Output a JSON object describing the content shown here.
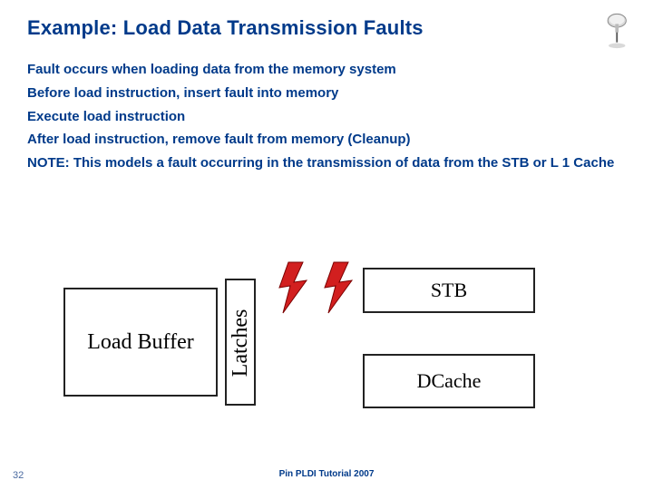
{
  "title": "Example: Load Data Transmission Faults",
  "bullets": {
    "b1": "Fault occurs when loading data from the memory system",
    "b2": "Before load instruction, insert fault into memory",
    "b3": "Execute load instruction",
    "b4": "After load instruction, remove fault from memory (Cleanup)",
    "b5": "NOTE: This models a fault occurring in the transmission of data from the STB or L 1 Cache"
  },
  "diagram": {
    "load_buffer": "Load Buffer",
    "latches": "Latches",
    "stb": "STB",
    "dcache": "DCache"
  },
  "footer": "Pin PLDI Tutorial 2007",
  "page_number": "32"
}
